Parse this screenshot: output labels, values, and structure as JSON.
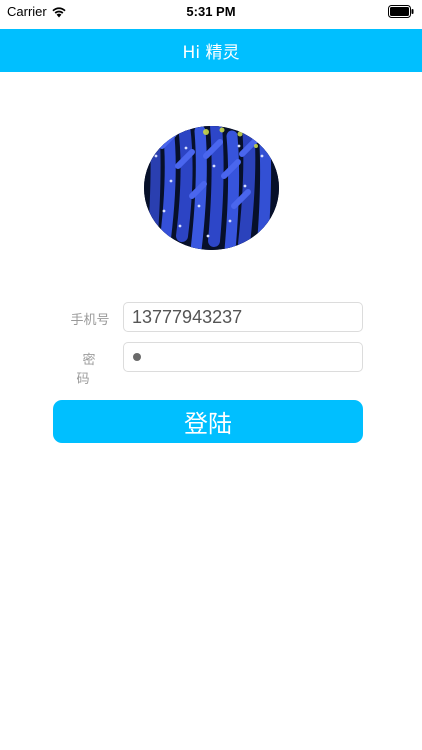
{
  "status_bar": {
    "carrier": "Carrier",
    "time": "5:31 PM",
    "icons": [
      "wifi-icon",
      "battery-icon"
    ]
  },
  "nav": {
    "title": "Hi 精灵"
  },
  "avatar": {
    "icon": "avatar-coral-image"
  },
  "form": {
    "phone_label": "手机号",
    "phone_value": "13777943237",
    "password_label": "密码",
    "password_mask": "●"
  },
  "login_button": {
    "label": "登陆"
  },
  "colors": {
    "accent": "#00BFFF",
    "input_border": "#dcdcdc",
    "label_text": "#9a9a9a"
  }
}
